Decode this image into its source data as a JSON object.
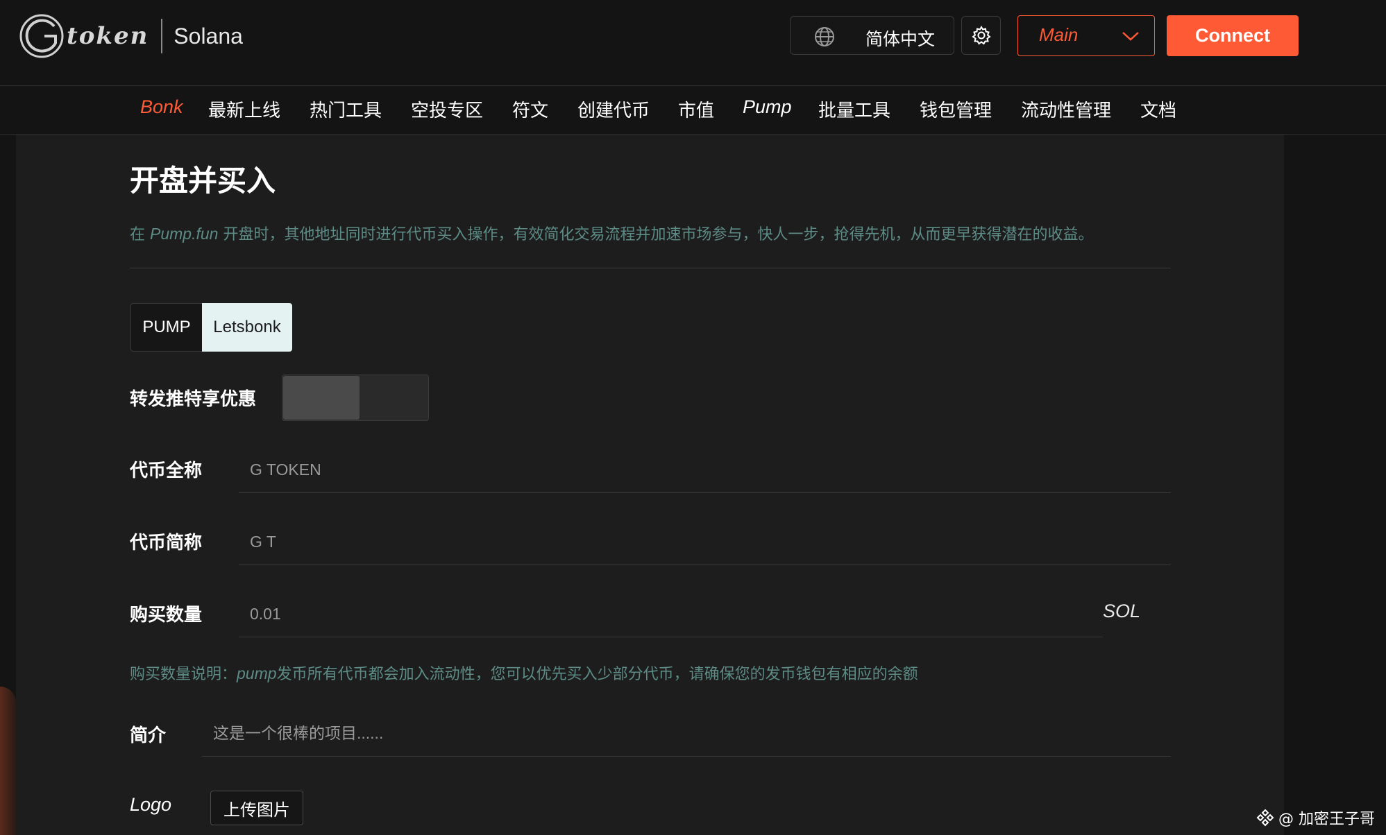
{
  "header": {
    "logo_text": "token",
    "chain": "Solana",
    "language": "简体中文",
    "network": "Main",
    "connect_label": "Connect"
  },
  "nav": [
    {
      "label": "Bonk",
      "active": true
    },
    {
      "label": "最新上线"
    },
    {
      "label": "热门工具"
    },
    {
      "label": "空投专区"
    },
    {
      "label": "符文"
    },
    {
      "label": "创建代币"
    },
    {
      "label": "市值"
    },
    {
      "label": "Pump"
    },
    {
      "label": "批量工具"
    },
    {
      "label": "钱包管理"
    },
    {
      "label": "流动性管理"
    },
    {
      "label": "文档"
    }
  ],
  "page": {
    "title": "开盘并买入",
    "desc_prefix": "在 ",
    "desc_brand": "Pump.fun",
    "desc_rest": " 开盘时，其他地址同时进行代币买入操作，有效简化交易流程并加速市场参与，快人一步，抢得先机，从而更早获得潜在的收益。"
  },
  "platform_tabs": {
    "pump": "PUMP",
    "letsbonk": "Letsbonk",
    "selected": "Letsbonk"
  },
  "form": {
    "retweet_label": "转发推特享优惠",
    "retweet_enabled": false,
    "token_name_label": "代币全称",
    "token_name_placeholder": "G TOKEN",
    "token_symbol_label": "代币简称",
    "token_symbol_placeholder": "G T",
    "buy_amount_label": "购买数量",
    "buy_amount_placeholder": "0.01",
    "buy_amount_unit": "SOL",
    "hint_prefix": "购买数量说明：",
    "hint_brand": "pump",
    "hint_rest": "发币所有代币都会加入流动性，您可以优先买入少部分代币，请确保您的发币钱包有相应的余额",
    "intro_label": "简介",
    "intro_placeholder": "这是一个很棒的项目......",
    "logo_label": "Logo",
    "upload_label": "上传图片"
  },
  "watermark": "@ 加密王子哥",
  "colors": {
    "accent": "#ff5a36",
    "hint": "#5d8c86",
    "background": "#141414",
    "panel": "#1d1d1d"
  }
}
